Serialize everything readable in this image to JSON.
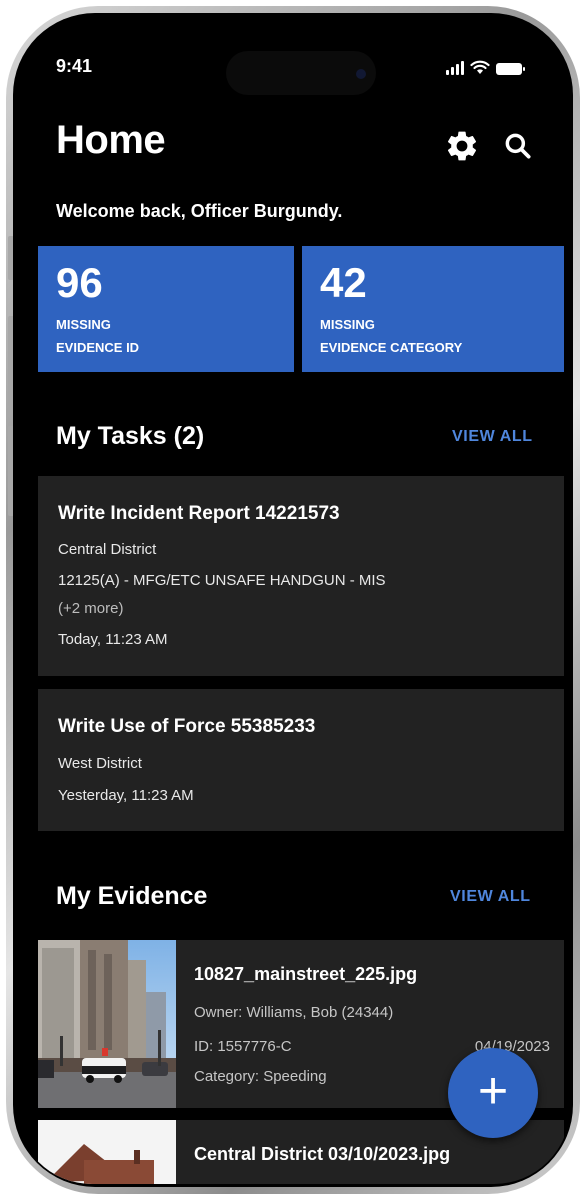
{
  "status": {
    "time": "9:41"
  },
  "header": {
    "title": "Home"
  },
  "welcome": "Welcome back, Officer Burgundy.",
  "stats": [
    {
      "value": "96",
      "label_1": "MISSING",
      "label_2": "EVIDENCE ID"
    },
    {
      "value": "42",
      "label_1": "MISSING",
      "label_2": "EVIDENCE CATEGORY"
    }
  ],
  "tasks": {
    "heading": "My Tasks (2)",
    "view_all": "VIEW ALL",
    "items": [
      {
        "title": "Write Incident Report 14221573",
        "district": "Central District",
        "charge": "12125(A) - MFG/ETC UNSAFE HANDGUN - MIS",
        "more": "(+2 more)",
        "time": "Today, 11:23 AM"
      },
      {
        "title": "Write Use of Force 55385233",
        "district": "West District",
        "time": "Yesterday, 11:23 AM"
      }
    ]
  },
  "evidence": {
    "heading": "My Evidence",
    "view_all": "VIEW ALL",
    "items": [
      {
        "title": "10827_mainstreet_225.jpg",
        "owner": "Owner: Williams, Bob (24344)",
        "id": "ID: 1557776-C",
        "date": "04/19/2023",
        "category": "Category: Speeding"
      },
      {
        "title": "Central District 03/10/2023.jpg"
      }
    ]
  },
  "fab": {
    "label": "+"
  },
  "colors": {
    "accent": "#2f63c0",
    "link": "#4f86dc",
    "card": "#222222",
    "background": "#000000"
  },
  "icons": [
    "signal-icon",
    "wifi-icon",
    "battery-icon",
    "gear-icon",
    "search-icon",
    "plus-icon"
  ]
}
